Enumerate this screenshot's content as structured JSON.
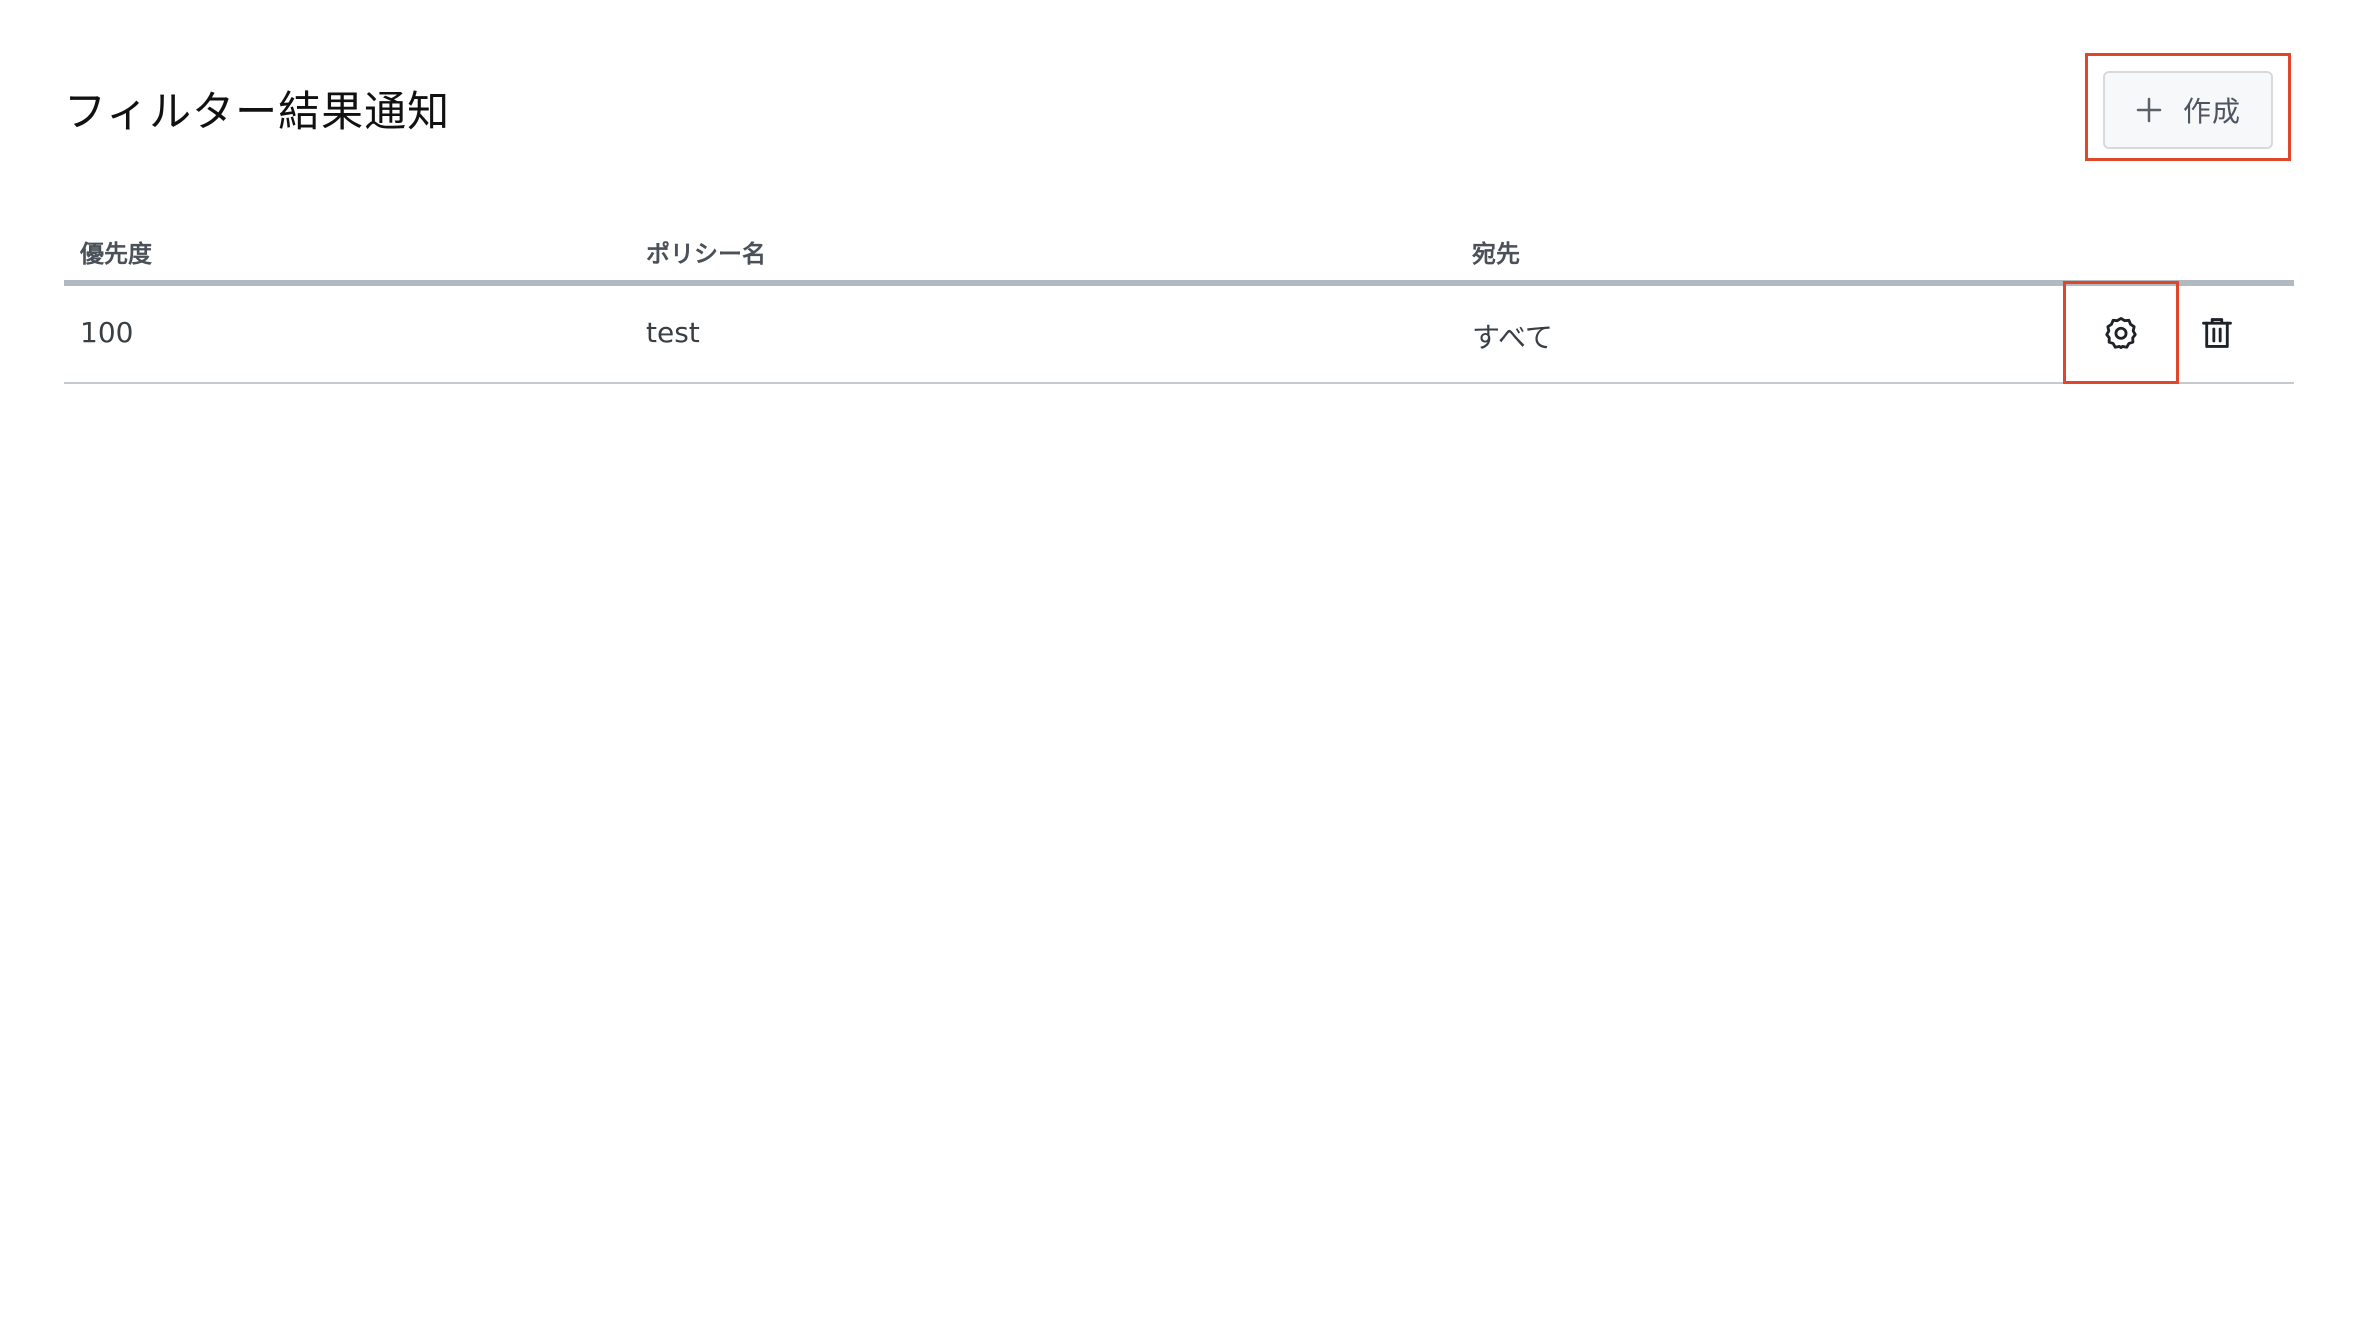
{
  "header": {
    "title": "フィルター結果通知",
    "create_label": "作成",
    "create_icon": "plus-icon"
  },
  "table": {
    "columns": [
      "優先度",
      "ポリシー名",
      "宛先"
    ],
    "rows": [
      {
        "priority": "100",
        "policy_name": "test",
        "destination": "すべて",
        "actions": [
          "gear-icon",
          "trash-icon"
        ]
      }
    ]
  },
  "colors": {
    "highlight": "#e0462b",
    "header_rule": "#b2b9c1",
    "row_rule": "#c4c9cf",
    "button_bg": "#f7f8f9"
  }
}
